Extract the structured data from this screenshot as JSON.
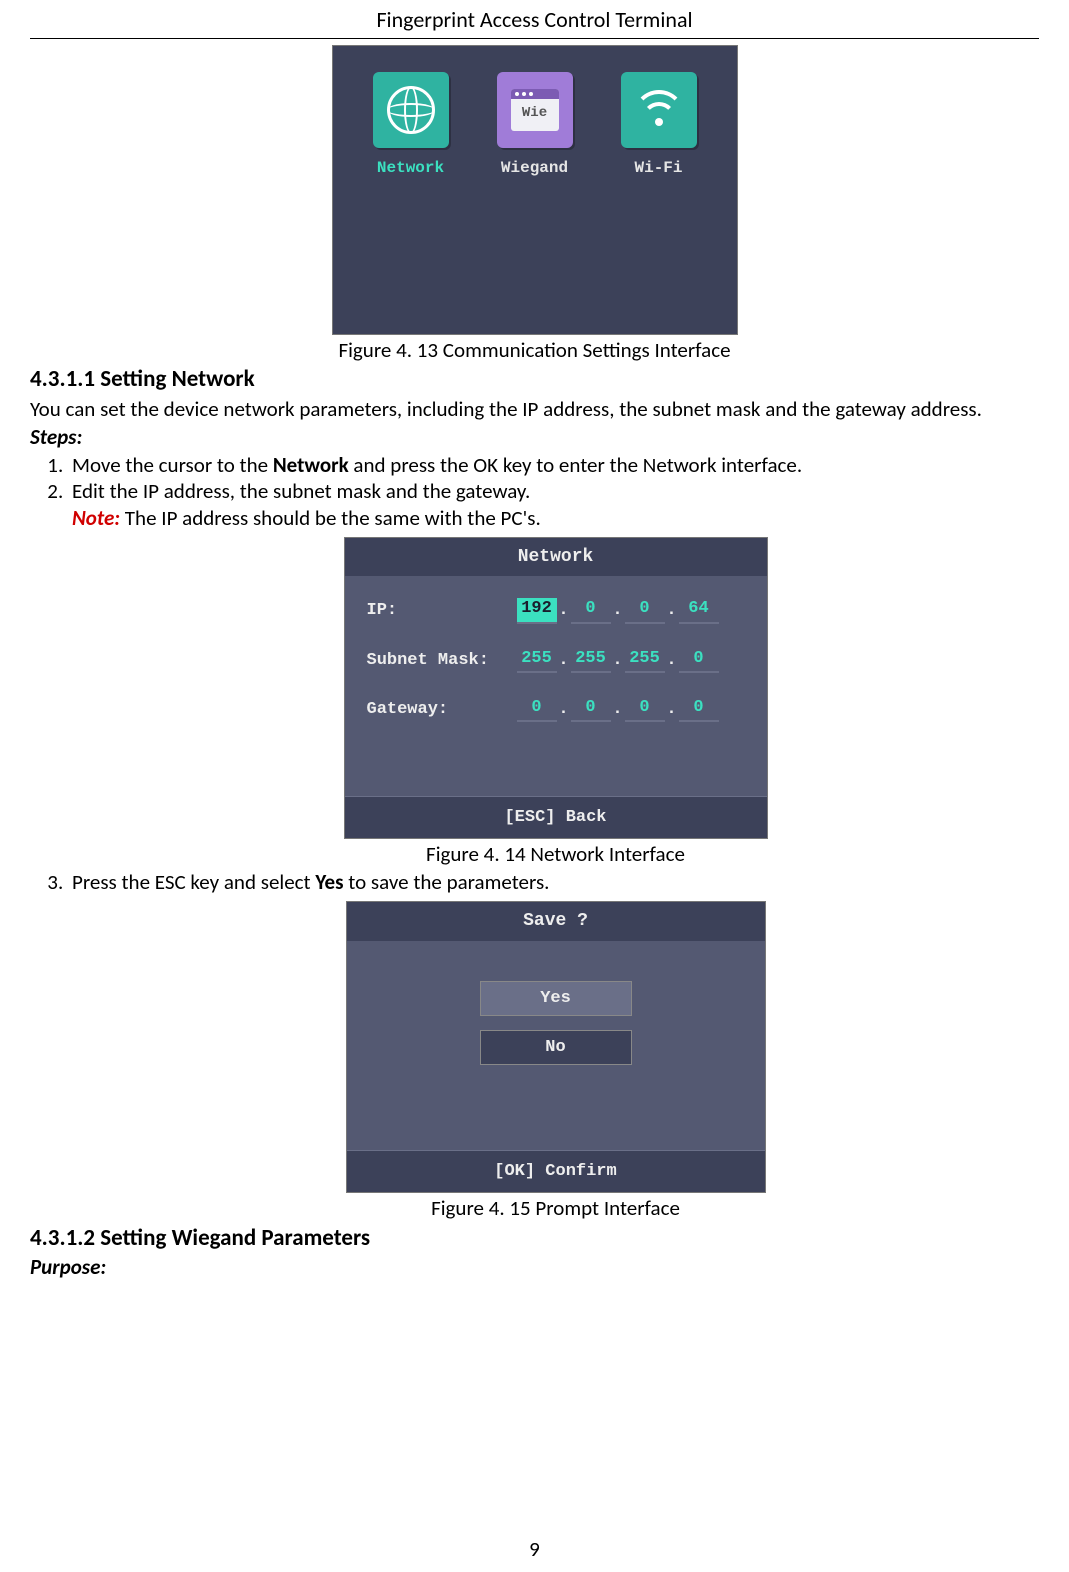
{
  "doc": {
    "title": "Fingerprint Access Control Terminal",
    "page_number": "9"
  },
  "fig1": {
    "caption": "Figure 4. 13  Communication Settings Interface",
    "items": {
      "network": "Network",
      "wiegand": "Wiegand",
      "wifi": "Wi-Fi",
      "wie_icon_text": "Wie"
    }
  },
  "section1": {
    "heading": "4.3.1.1 Setting Network",
    "intro": "You can set the device network parameters, including the IP address, the subnet mask and the gateway address.",
    "steps_label": "Steps:",
    "step1_a": "Move the cursor to the ",
    "step1_b": "Network",
    "step1_c": " and press the OK key to enter the Network interface.",
    "step2": "Edit the IP address, the subnet mask and the gateway.",
    "note_label": "Note:",
    "note_text": " The IP address should be the same with the PC's.",
    "step3_a": "Press the ESC key and select ",
    "step3_b": "Yes",
    "step3_c": " to save the parameters."
  },
  "fig2": {
    "caption": "Figure 4. 14 Network Interface",
    "title": "Network",
    "ip_label": "IP:",
    "ip": [
      "192",
      "0",
      "0",
      "64"
    ],
    "mask_label": "Subnet Mask:",
    "mask": [
      "255",
      "255",
      "255",
      "0"
    ],
    "gw_label": "Gateway:",
    "gw": [
      "0",
      "0",
      "0",
      "0"
    ],
    "footer": "[ESC] Back"
  },
  "fig3": {
    "caption": "Figure 4. 15 Prompt Interface",
    "title": "Save ?",
    "yes": "Yes",
    "no": "No",
    "footer": "[OK] Confirm"
  },
  "section2": {
    "heading": "4.3.1.2 Setting Wiegand Parameters",
    "purpose": "Purpose:"
  }
}
